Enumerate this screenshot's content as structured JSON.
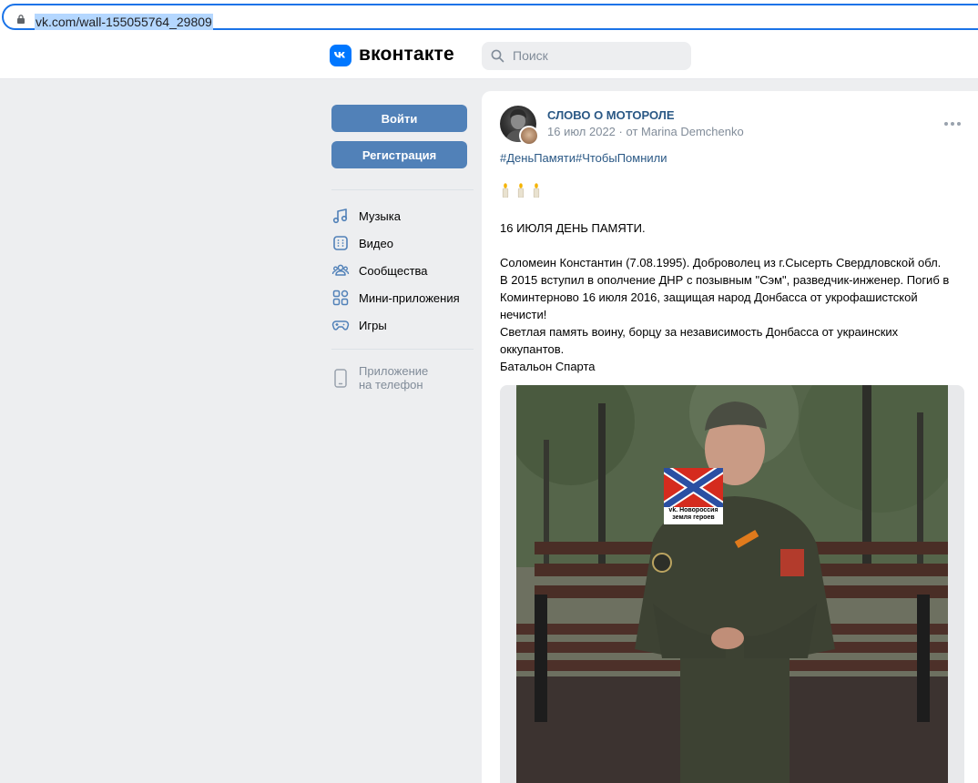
{
  "browser": {
    "url": "vk.com/wall-155055764_29809"
  },
  "header": {
    "logo_text": "вконтакте",
    "search_placeholder": "Поиск",
    "brand_color": "#0077ff"
  },
  "sidebar": {
    "login_label": "Войти",
    "register_label": "Регистрация",
    "items": [
      {
        "label": "Музыка",
        "icon": "music-icon"
      },
      {
        "label": "Видео",
        "icon": "video-icon"
      },
      {
        "label": "Сообщества",
        "icon": "communities-icon"
      },
      {
        "label": "Мини-приложения",
        "icon": "mini-apps-icon"
      },
      {
        "label": "Игры",
        "icon": "games-icon"
      }
    ],
    "app_line1": "Приложение",
    "app_line2": "на телефон",
    "button_color": "#5181b8"
  },
  "post": {
    "group_name": "СЛОВО О МОТОРОЛЕ",
    "date": "16 июл 2022",
    "author": "от Marina Demchenko",
    "hashtags": "#ДеньПамяти#ЧтобыПомнили",
    "candles": "🕯🕯🕯",
    "headline": "16 ИЮЛЯ ДЕНЬ ПАМЯТИ.",
    "body_lines": [
      "Соломеин Константин (7.08.1995). Доброволец из г.Сысерть Свердловской обл.",
      "В 2015 вступил в ополчение ДНР с позывным \"Сэм\", разведчик-инженер. Погиб в",
      "Коминтерново 16 июля 2016, защищая народ Донбасса от укрофашистской",
      "нечисти!",
      "Светлая память воину, борцу за независимость Донбасса от украинских",
      "оккупантов.",
      "Батальон Спарта"
    ],
    "photo_caption_line1": "vk. Новороссия",
    "photo_caption_line2": "земля героев",
    "link_color": "#2a5885"
  }
}
